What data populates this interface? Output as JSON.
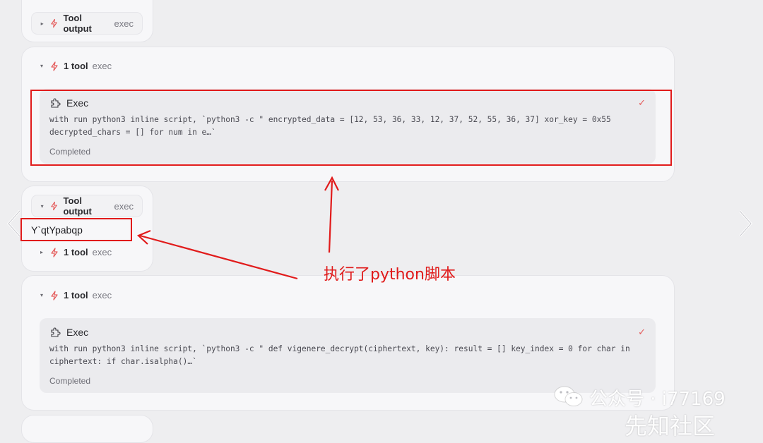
{
  "top_pill": {
    "title": "Tool output",
    "tag": "exec"
  },
  "card1": {
    "header": {
      "title": "1 tool",
      "tag": "exec"
    },
    "exec": {
      "title": "Exec",
      "code": "with run python3 inline script, `python3 -c \" encrypted_data = [12, 53, 36, 33, 12, 37, 52, 55, 36, 37] xor_key = 0x55 decrypted_chars = [] for num in e…`",
      "status": "Completed"
    }
  },
  "card2": {
    "pill": {
      "title": "Tool output",
      "tag": "exec"
    },
    "output_text": "Y`qtYpabqp",
    "row": {
      "title": "1 tool",
      "tag": "exec"
    }
  },
  "card3": {
    "header": {
      "title": "1 tool",
      "tag": "exec"
    },
    "exec": {
      "title": "Exec",
      "code": "with run python3 inline script, `python3 -c \" def vigenere_decrypt(ciphertext, key): result = [] key_index = 0 for char in ciphertext: if char.isalpha()…`",
      "status": "Completed"
    }
  },
  "annotation": {
    "text": "执行了python脚本"
  },
  "watermark": {
    "text": "公众号 · i77169",
    "text2": "先知社区"
  },
  "colors": {
    "accent_red": "#e11b1b",
    "bolt": "#e45b5b"
  },
  "icons": {
    "bolt": "lightning-bolt-icon",
    "puzzle": "puzzle-piece-icon",
    "check": "check-icon",
    "prev": "chevron-left-icon",
    "next": "chevron-right-icon"
  }
}
